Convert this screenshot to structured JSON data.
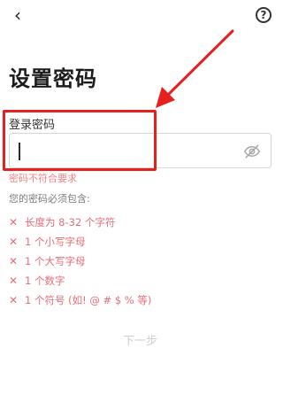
{
  "header": {
    "back_icon": "‹",
    "help_icon": "?"
  },
  "title": "设置密码",
  "password_field": {
    "label": "登录密码",
    "value": ""
  },
  "validation": {
    "error": "密码不符合要求",
    "requirements_title": "您的密码必须包含:",
    "requirements": [
      "长度为 8-32 个字符",
      "1 个小写字母",
      "1 个大写字母",
      "1 个数字",
      "1 个符号 (如! @ # $ % 等)"
    ]
  },
  "footer": {
    "next_label": "下一步"
  },
  "colors": {
    "annotation_red": "#e5201e",
    "error_pink": "#e56e79",
    "disabled_gray": "#cfcfcf"
  },
  "icons": {
    "back": "back-icon",
    "help": "help-icon",
    "visibility": "eye-off-icon",
    "requirement_status": "x-icon"
  }
}
